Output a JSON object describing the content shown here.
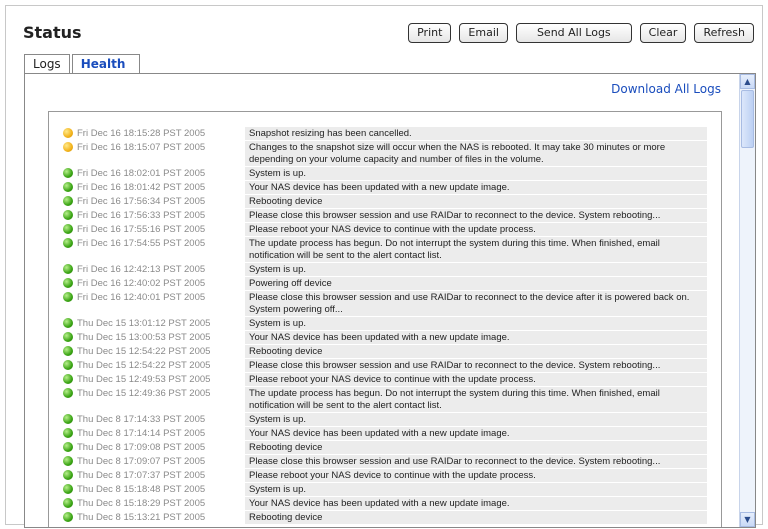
{
  "header": {
    "title": "Status"
  },
  "toolbar": {
    "print_label": "Print",
    "email_label": "Email",
    "send_all_logs_label": "Send All Logs",
    "clear_label": "Clear",
    "refresh_label": "Refresh"
  },
  "tabs": [
    {
      "label": "Logs",
      "active": true
    },
    {
      "label": "Health",
      "active": false
    }
  ],
  "panel": {
    "download_all_logs_label": "Download All Logs"
  },
  "logs": [
    {
      "status": "warning",
      "date": "Fri Dec 16 18:15:28 PST 2005",
      "message": "Snapshot resizing has been cancelled."
    },
    {
      "status": "warning",
      "date": "Fri Dec 16 18:15:07 PST 2005",
      "message": "Changes to the snapshot size will occur when the NAS is rebooted. It may take 30 minutes or more depending on your volume capacity and number of files in the volume."
    },
    {
      "status": "ok",
      "date": "Fri Dec 16 18:02:01 PST 2005",
      "message": "System is up."
    },
    {
      "status": "ok",
      "date": "Fri Dec 16 18:01:42 PST 2005",
      "message": "Your NAS device has been updated with a new update image."
    },
    {
      "status": "ok",
      "date": "Fri Dec 16 17:56:34 PST 2005",
      "message": "Rebooting device"
    },
    {
      "status": "ok",
      "date": "Fri Dec 16 17:56:33 PST 2005",
      "message": "Please close this browser session and use RAIDar to reconnect to the device. System rebooting..."
    },
    {
      "status": "ok",
      "date": "Fri Dec 16 17:55:16 PST 2005",
      "message": "Please reboot your NAS device to continue with the update process."
    },
    {
      "status": "ok",
      "date": "Fri Dec 16 17:54:55 PST 2005",
      "message": "The update process has begun. Do not interrupt the system during this time. When finished, email notification will be sent to the alert contact list."
    },
    {
      "status": "ok",
      "date": "Fri Dec 16 12:42:13 PST 2005",
      "message": "System is up."
    },
    {
      "status": "ok",
      "date": "Fri Dec 16 12:40:02 PST 2005",
      "message": "Powering off device"
    },
    {
      "status": "ok",
      "date": "Fri Dec 16 12:40:01 PST 2005",
      "message": "Please close this browser session and use RAIDar to reconnect to the device after it is powered back on. System powering off..."
    },
    {
      "status": "ok",
      "date": "Thu Dec 15 13:01:12 PST 2005",
      "message": "System is up."
    },
    {
      "status": "ok",
      "date": "Thu Dec 15 13:00:53 PST 2005",
      "message": "Your NAS device has been updated with a new update image."
    },
    {
      "status": "ok",
      "date": "Thu Dec 15 12:54:22 PST 2005",
      "message": "Rebooting device"
    },
    {
      "status": "ok",
      "date": "Thu Dec 15 12:54:22 PST 2005",
      "message": "Please close this browser session and use RAIDar to reconnect to the device. System rebooting..."
    },
    {
      "status": "ok",
      "date": "Thu Dec 15 12:49:53 PST 2005",
      "message": "Please reboot your NAS device to continue with the update process."
    },
    {
      "status": "ok",
      "date": "Thu Dec 15 12:49:36 PST 2005",
      "message": "The update process has begun. Do not interrupt the system during this time. When finished, email notification will be sent to the alert contact list."
    },
    {
      "status": "ok",
      "date": "Thu Dec 8 17:14:33 PST 2005",
      "message": "System is up."
    },
    {
      "status": "ok",
      "date": "Thu Dec 8 17:14:14 PST 2005",
      "message": "Your NAS device has been updated with a new update image."
    },
    {
      "status": "ok",
      "date": "Thu Dec 8 17:09:08 PST 2005",
      "message": "Rebooting device"
    },
    {
      "status": "ok",
      "date": "Thu Dec 8 17:09:07 PST 2005",
      "message": "Please close this browser session and use RAIDar to reconnect to the device. System rebooting..."
    },
    {
      "status": "ok",
      "date": "Thu Dec 8 17:07:37 PST 2005",
      "message": "Please reboot your NAS device to continue with the update process."
    },
    {
      "status": "ok",
      "date": "Thu Dec 8 15:18:48 PST 2005",
      "message": "System is up."
    },
    {
      "status": "ok",
      "date": "Thu Dec 8 15:18:29 PST 2005",
      "message": "Your NAS device has been updated with a new update image."
    },
    {
      "status": "ok",
      "date": "Thu Dec 8 15:13:21 PST 2005",
      "message": "Rebooting device"
    }
  ],
  "icons": {
    "warning": "yellow-status-dot",
    "ok": "green-status-dot",
    "scroll_up": "chevron-up-icon",
    "scroll_down": "chevron-down-icon"
  }
}
